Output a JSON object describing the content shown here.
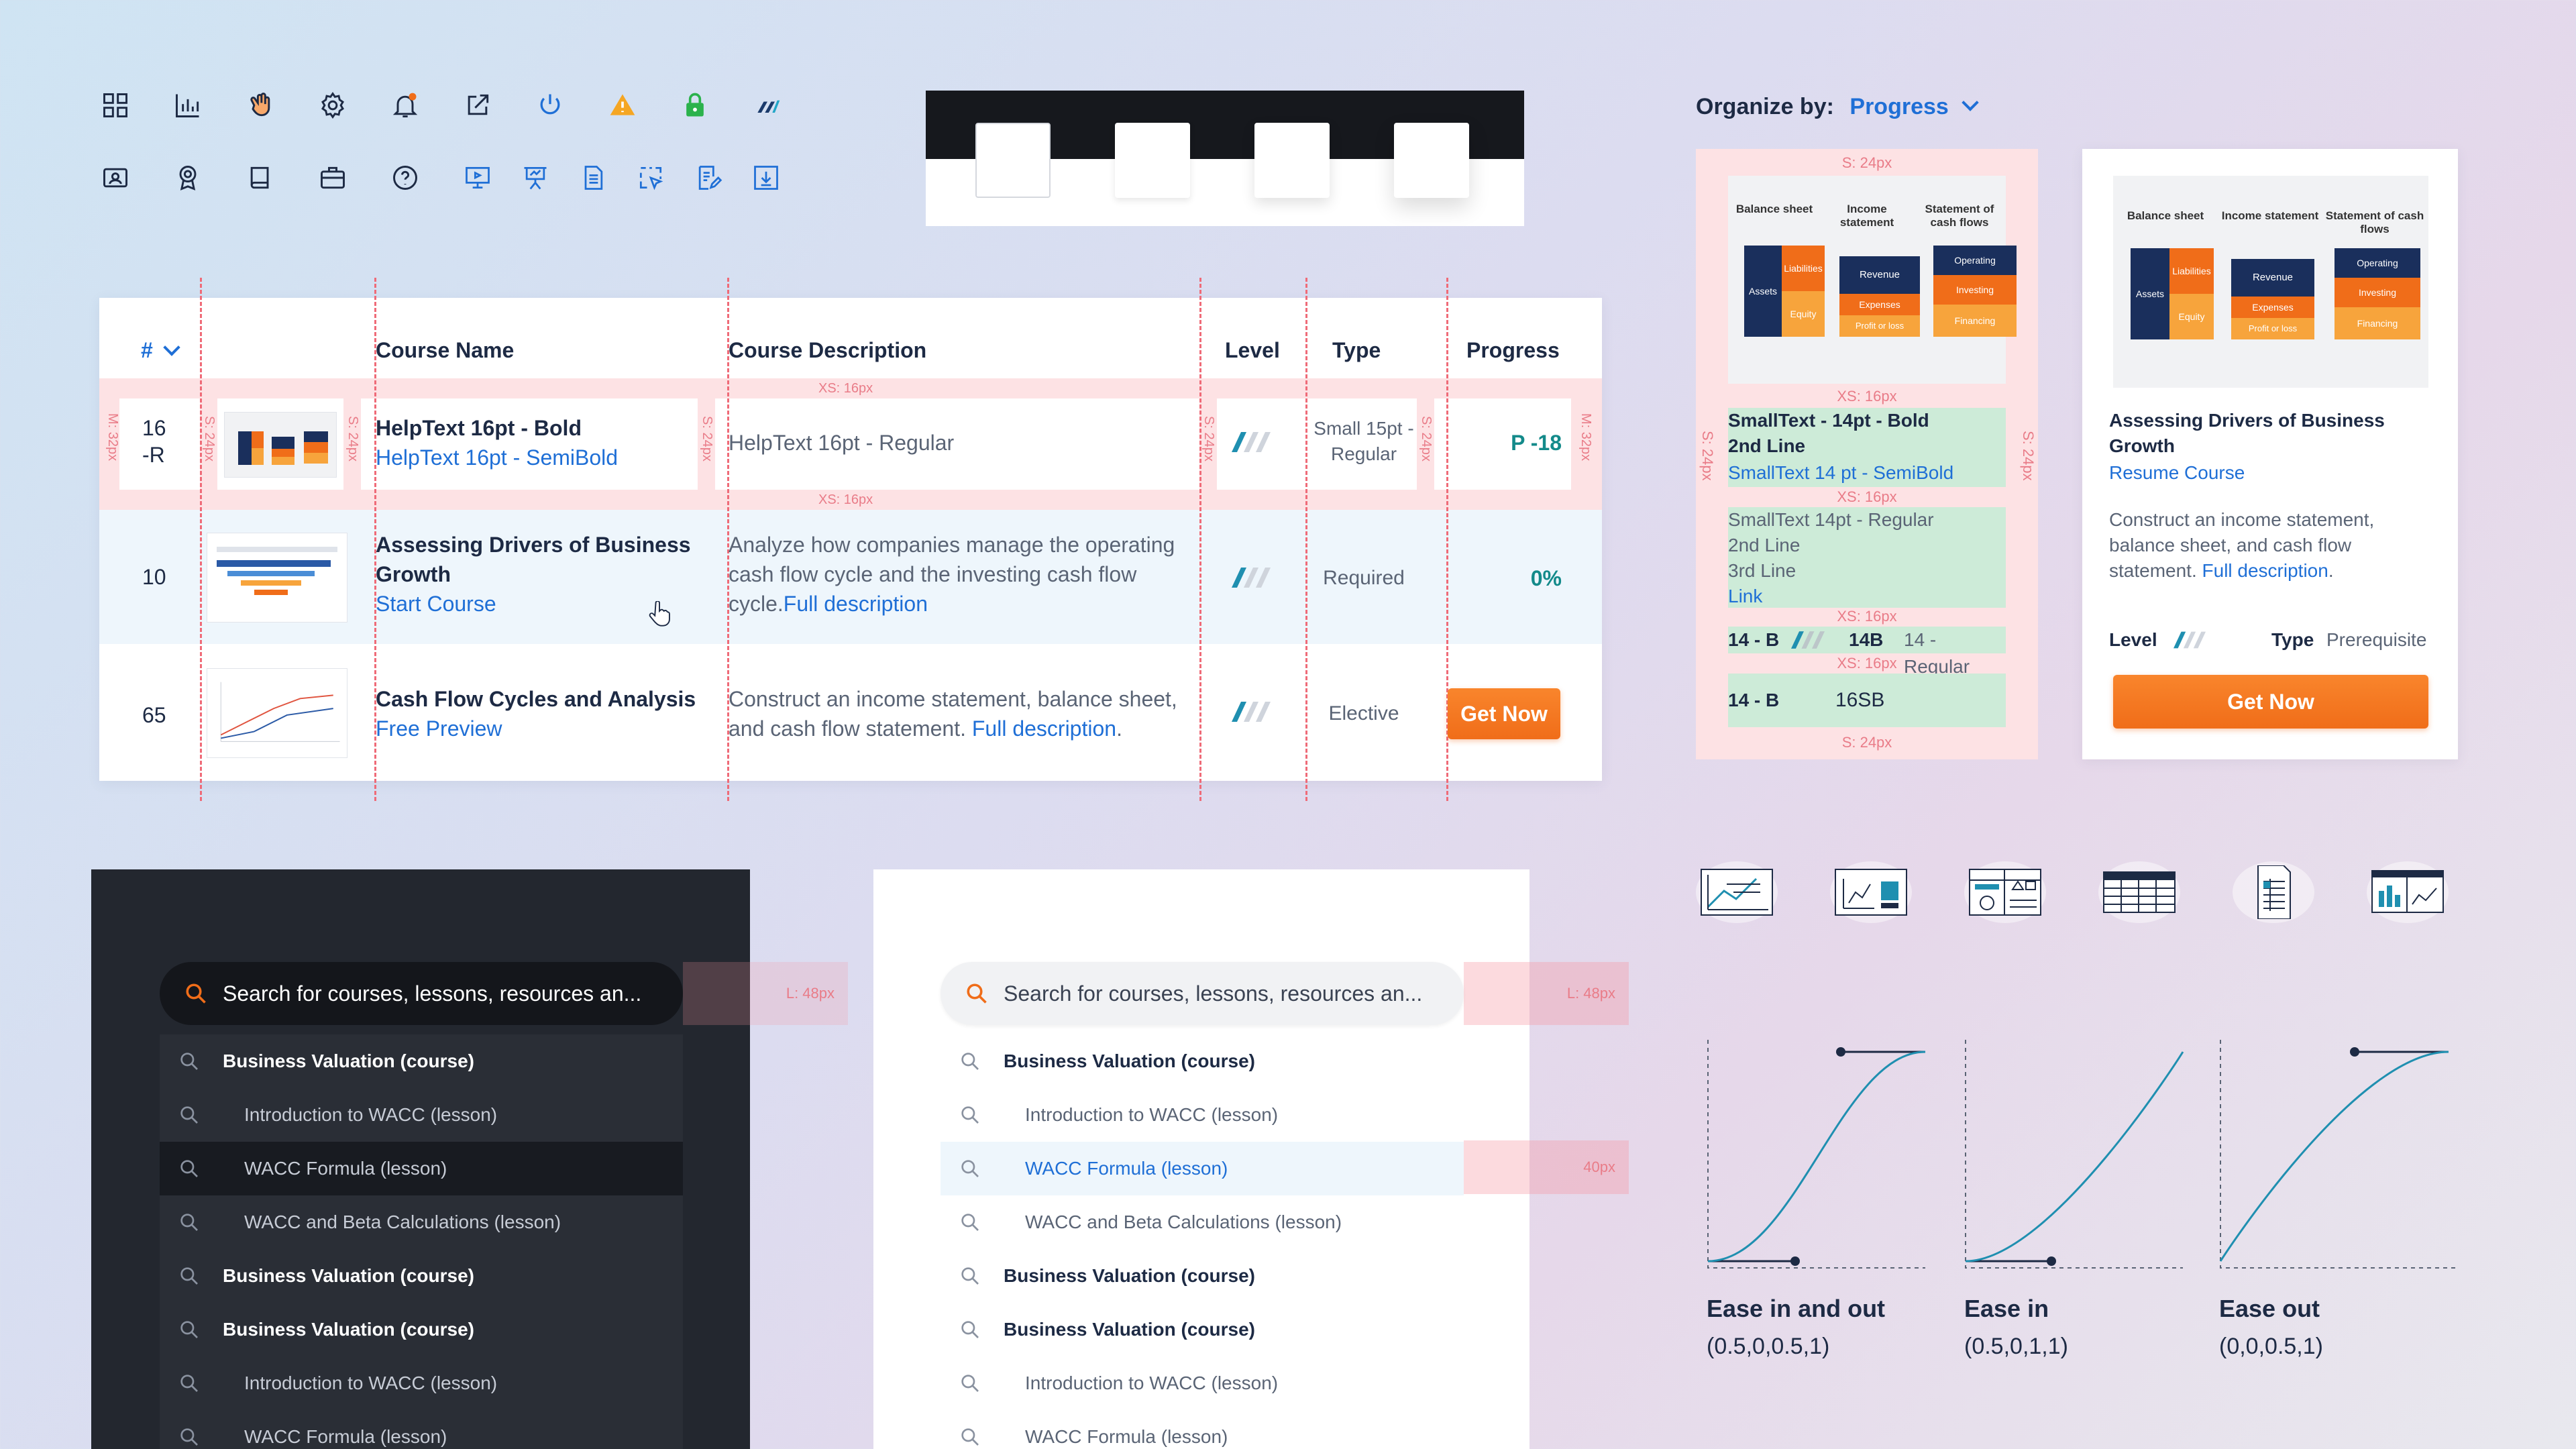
{
  "icons": {
    "row1": [
      "grid-icon",
      "bar-chart-icon",
      "hand-wave-icon",
      "gear-icon",
      "notification-bell-icon",
      "external-link-icon",
      "power-icon",
      "warning-icon",
      "lock-icon",
      "brand-logo-icon"
    ],
    "row2": [
      "id-card-icon",
      "award-icon",
      "book-icon",
      "briefcase-icon",
      "help-icon",
      "presentation-icon",
      "easel-icon",
      "document-icon",
      "select-icon",
      "edit-document-icon",
      "download-icon"
    ],
    "accent": "#1f6fd6",
    "warning": "#f5a623",
    "lock": "#2bb24c"
  },
  "table": {
    "headers": {
      "num": "#",
      "course_name": "Course Name",
      "course_description": "Course Description",
      "level": "Level",
      "type": "Type",
      "progress": "Progress"
    },
    "spacing": {
      "xs_top": "XS: 16px",
      "xs_bottom": "XS: 16px",
      "m_left": "M: 32px",
      "s_a": "S: 24px",
      "s_b": "S: 24px",
      "s_c": "S: 24px",
      "s_d": "S: 24px",
      "s_e": "S: 24px",
      "m_right": "M: 32px"
    },
    "spec_row": {
      "num": "16\n-R",
      "title": "HelpText 16pt - Bold",
      "subtitle": "HelpText 16pt - SemiBold",
      "description": "HelpText 16pt - Regular",
      "type": "Small 15pt -\nRegular",
      "progress": "P -18"
    },
    "rows": [
      {
        "num": "10",
        "title": "Assessing Drivers of Business Growth",
        "action": "Start Course",
        "description": "Analyze how companies manage the operating cash flow cycle and the investing cash flow cycle.",
        "desc_link": "Full description",
        "type": "Required",
        "progress": "0%"
      },
      {
        "num": "65",
        "title": "Cash Flow Cycles and Analysis",
        "action": "Free Preview",
        "description": "Construct an income statement, balance sheet, and cash flow statement.",
        "desc_link": "Full description",
        "type": "Elective",
        "progress_button": "Get Now"
      }
    ]
  },
  "organize": {
    "label": "Organize by:",
    "value": "Progress"
  },
  "fin_diagram": {
    "headers": [
      "Balance sheet",
      "Income statement",
      "Statement of cash flows"
    ],
    "assets": "Assets",
    "liabilities": "Liabilities",
    "equity": "Equity",
    "revenue": "Revenue",
    "expenses": "Expenses",
    "profit": "Profit or loss",
    "operating": "Operating",
    "investing": "Investing",
    "financing": "Financing"
  },
  "spec_card": {
    "s_top": "S: 24px",
    "s_bottom": "S: 24px",
    "s_left": "S: 24px",
    "s_right": "S: 24px",
    "xs_1": "XS: 16px",
    "xs_2": "XS: 16px",
    "xs_3": "XS: 16px",
    "xs_4": "XS: 16px",
    "title": "SmallText - 14pt - Bold\n2nd Line",
    "subtitle": "SmallText 14 pt - SemiBold",
    "body": "SmallText 14pt - Regular\n2nd Line\n3rd Line",
    "body_link": "Link",
    "level_lbl": "14 - B",
    "type_lbl": "14B",
    "type_val": "14 - Regular",
    "btn_lbl": "14 - B",
    "btn_val": "16SB"
  },
  "course_card": {
    "title": "Assessing Drivers of Business Growth",
    "action": "Resume Course",
    "description": "Construct an income statement, balance sheet, and cash flow statement.",
    "desc_link": "Full description",
    "level_label": "Level",
    "type_label": "Type",
    "type_value": "Prerequisite",
    "button": "Get Now"
  },
  "search_dark": {
    "placeholder": "Search for courses, lessons, resources an...",
    "margin_tag": "L: 48px",
    "items": [
      {
        "label": "Business Valuation (course)",
        "kind": "course"
      },
      {
        "label": "Introduction to WACC (lesson)",
        "kind": "lesson"
      },
      {
        "label": "WACC Formula (lesson)",
        "kind": "lesson",
        "active": true
      },
      {
        "label": "WACC and Beta Calculations (lesson)",
        "kind": "lesson"
      },
      {
        "label": "Business Valuation (course)",
        "kind": "course"
      },
      {
        "label": "Business Valuation (course)",
        "kind": "course"
      },
      {
        "label": "Introduction to WACC (lesson)",
        "kind": "lesson"
      },
      {
        "label": "WACC Formula (lesson)",
        "kind": "lesson"
      }
    ]
  },
  "search_light": {
    "placeholder": "Search for courses, lessons, resources an...",
    "margin_tag": "L: 48px",
    "item_tag": "40px",
    "items": [
      {
        "label": "Business Valuation (course)",
        "kind": "course"
      },
      {
        "label": "Introduction to WACC (lesson)",
        "kind": "lesson"
      },
      {
        "label": "WACC Formula (lesson)",
        "kind": "lesson",
        "active": true
      },
      {
        "label": "WACC and Beta Calculations (lesson)",
        "kind": "lesson"
      },
      {
        "label": "Business Valuation (course)",
        "kind": "course"
      },
      {
        "label": "Business Valuation (course)",
        "kind": "course"
      },
      {
        "label": "Introduction to WACC (lesson)",
        "kind": "lesson"
      },
      {
        "label": "WACC Formula (lesson)",
        "kind": "lesson"
      }
    ]
  },
  "chart_icons": [
    "line-chart-icon",
    "bar-chart-icon",
    "dashboard-icon",
    "table-icon",
    "spreadsheet-icon",
    "chart-table-icon"
  ],
  "easing": [
    {
      "label": "Ease in and out",
      "value": "(0.5,0,0.5,1)"
    },
    {
      "label": "Ease in",
      "value": "(0.5,0,1,1)"
    },
    {
      "label": "Ease out",
      "value": "(0,0,0.5,1)"
    }
  ]
}
